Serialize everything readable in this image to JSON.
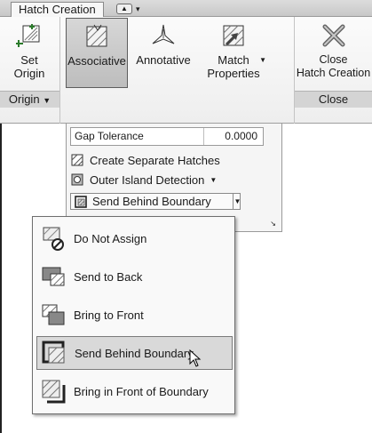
{
  "tabs": {
    "active": "Hatch Creation"
  },
  "panels": {
    "origin": {
      "title": "Origin",
      "set_origin": "Set\nOrigin"
    },
    "options": {
      "associative": "Associative",
      "annotative": "Annotative",
      "match_properties": "Match\nProperties"
    },
    "close": {
      "title": "Close",
      "close_button": "Close\nHatch Creation"
    }
  },
  "dropdown": {
    "gap_tolerance_label": "Gap Tolerance",
    "gap_tolerance_value": "0.0000",
    "create_separate": "Create Separate Hatches",
    "outer_island": "Outer Island Detection",
    "draw_order_selected": "Send Behind Boundary"
  },
  "menu": {
    "items": [
      {
        "label": "Do Not Assign"
      },
      {
        "label": "Send to Back"
      },
      {
        "label": "Bring to Front"
      },
      {
        "label": "Send Behind Boundary"
      },
      {
        "label": "Bring in Front of Boundary"
      }
    ]
  }
}
